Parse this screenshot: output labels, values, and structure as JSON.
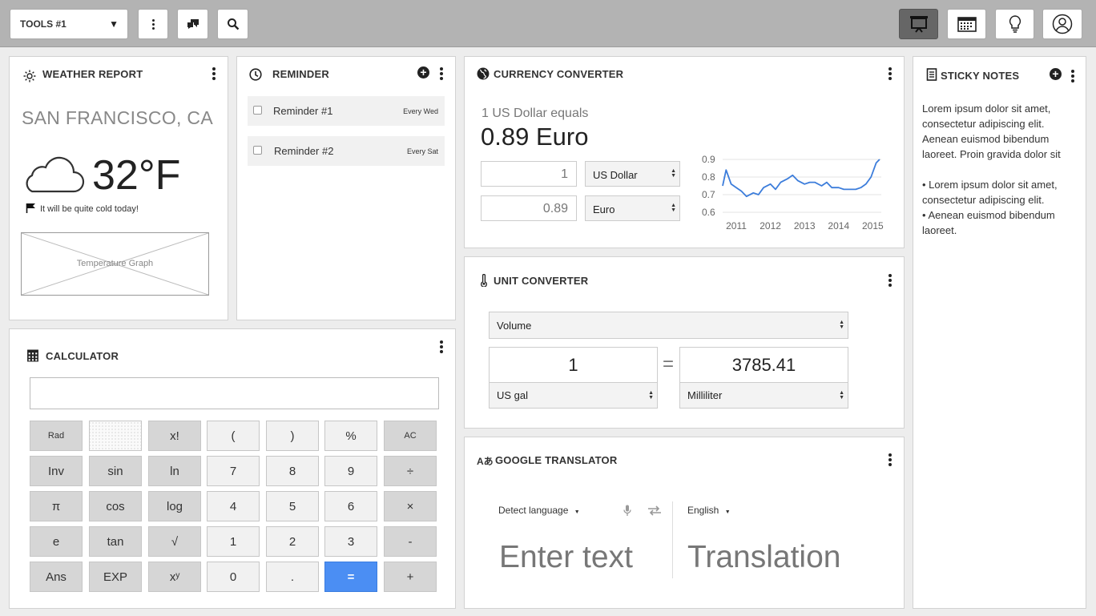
{
  "toolbar": {
    "tools_label": "TOOLS #1",
    "icons": [
      "more-vert-icon",
      "chat-icon",
      "search-icon",
      "presentation-icon",
      "calendar-icon",
      "lightbulb-icon",
      "user-icon"
    ]
  },
  "weather": {
    "title": "WEATHER REPORT",
    "city": "SAN FRANCISCO, CA",
    "temperature": "32°F",
    "note": "It will be quite cold today!",
    "graph_placeholder": "Temperature Graph"
  },
  "reminder": {
    "title": "REMINDER",
    "items": [
      {
        "label": "Reminder #1",
        "repeat": "Every Wed"
      },
      {
        "label": "Reminder #2",
        "repeat": "Every Sat"
      }
    ]
  },
  "currency": {
    "title": "CURRENCY CONVERTER",
    "equals_text": "1 US Dollar equals",
    "result": "0.89 Euro",
    "from_value": "1",
    "from_currency": "US Dollar",
    "to_value": "0.89",
    "to_currency": "Euro"
  },
  "chart_data": {
    "type": "line",
    "title": "",
    "xlabel": "",
    "ylabel": "",
    "x_ticks": [
      "2011",
      "2012",
      "2013",
      "2014",
      "2015"
    ],
    "y_ticks": [
      "0.9",
      "0.8",
      "0.7",
      "0.6"
    ],
    "ylim": [
      0.6,
      0.9
    ],
    "grid": true,
    "series": [
      {
        "x": [
          2010.6,
          2010.7,
          2010.85,
          2011.0,
          2011.15,
          2011.3,
          2011.5,
          2011.65,
          2011.8,
          2012.0,
          2012.15,
          2012.3,
          2012.5,
          2012.65,
          2012.8,
          2013.0,
          2013.15,
          2013.3,
          2013.5,
          2013.65,
          2013.8,
          2014.0,
          2014.15,
          2014.3,
          2014.5,
          2014.65,
          2014.8,
          2014.95,
          2015.1,
          2015.2
        ],
        "y": [
          0.75,
          0.84,
          0.76,
          0.74,
          0.72,
          0.69,
          0.71,
          0.7,
          0.74,
          0.76,
          0.73,
          0.77,
          0.79,
          0.81,
          0.78,
          0.76,
          0.77,
          0.77,
          0.75,
          0.77,
          0.74,
          0.74,
          0.73,
          0.73,
          0.73,
          0.74,
          0.76,
          0.8,
          0.88,
          0.9
        ],
        "color": "#3c7ddb"
      }
    ]
  },
  "unit": {
    "title": "UNIT CONVERTER",
    "category": "Volume",
    "from_value": "1",
    "from_unit": "US gal",
    "equals": "=",
    "to_value": "3785.41",
    "to_unit": "Milliliter"
  },
  "calculator": {
    "title": "CALCULATOR",
    "rows": [
      [
        "Rad",
        "",
        "x!",
        "(",
        ")",
        "%",
        "AC"
      ],
      [
        "Inv",
        "sin",
        "ln",
        "7",
        "8",
        "9",
        "÷"
      ],
      [
        "π",
        "cos",
        "log",
        "4",
        "5",
        "6",
        "×"
      ],
      [
        "e",
        "tan",
        "√",
        "1",
        "2",
        "3",
        "-"
      ],
      [
        "Ans",
        "EXP",
        "xʸ",
        "0",
        ".",
        "=",
        "+"
      ]
    ]
  },
  "translator": {
    "title": "GOOGLE TRANSLATOR",
    "source_lang": "Detect language",
    "target_lang": "English",
    "input_placeholder": "Enter text",
    "output": "Translation"
  },
  "sticky": {
    "title": "STICKY NOTES",
    "paragraph": "Lorem ipsum dolor sit amet, consectetur adipiscing elit. Aenean euismod bibendum laoreet. Proin gravida dolor sit",
    "bullets": [
      "Lorem ipsum dolor sit amet, consectetur adipiscing elit.",
      "Aenean euismod bibendum laoreet."
    ]
  },
  "colors": {
    "accent": "#4b8ef3",
    "chart_line": "#3c7ddb",
    "toolbar": "#b3b3b3"
  }
}
